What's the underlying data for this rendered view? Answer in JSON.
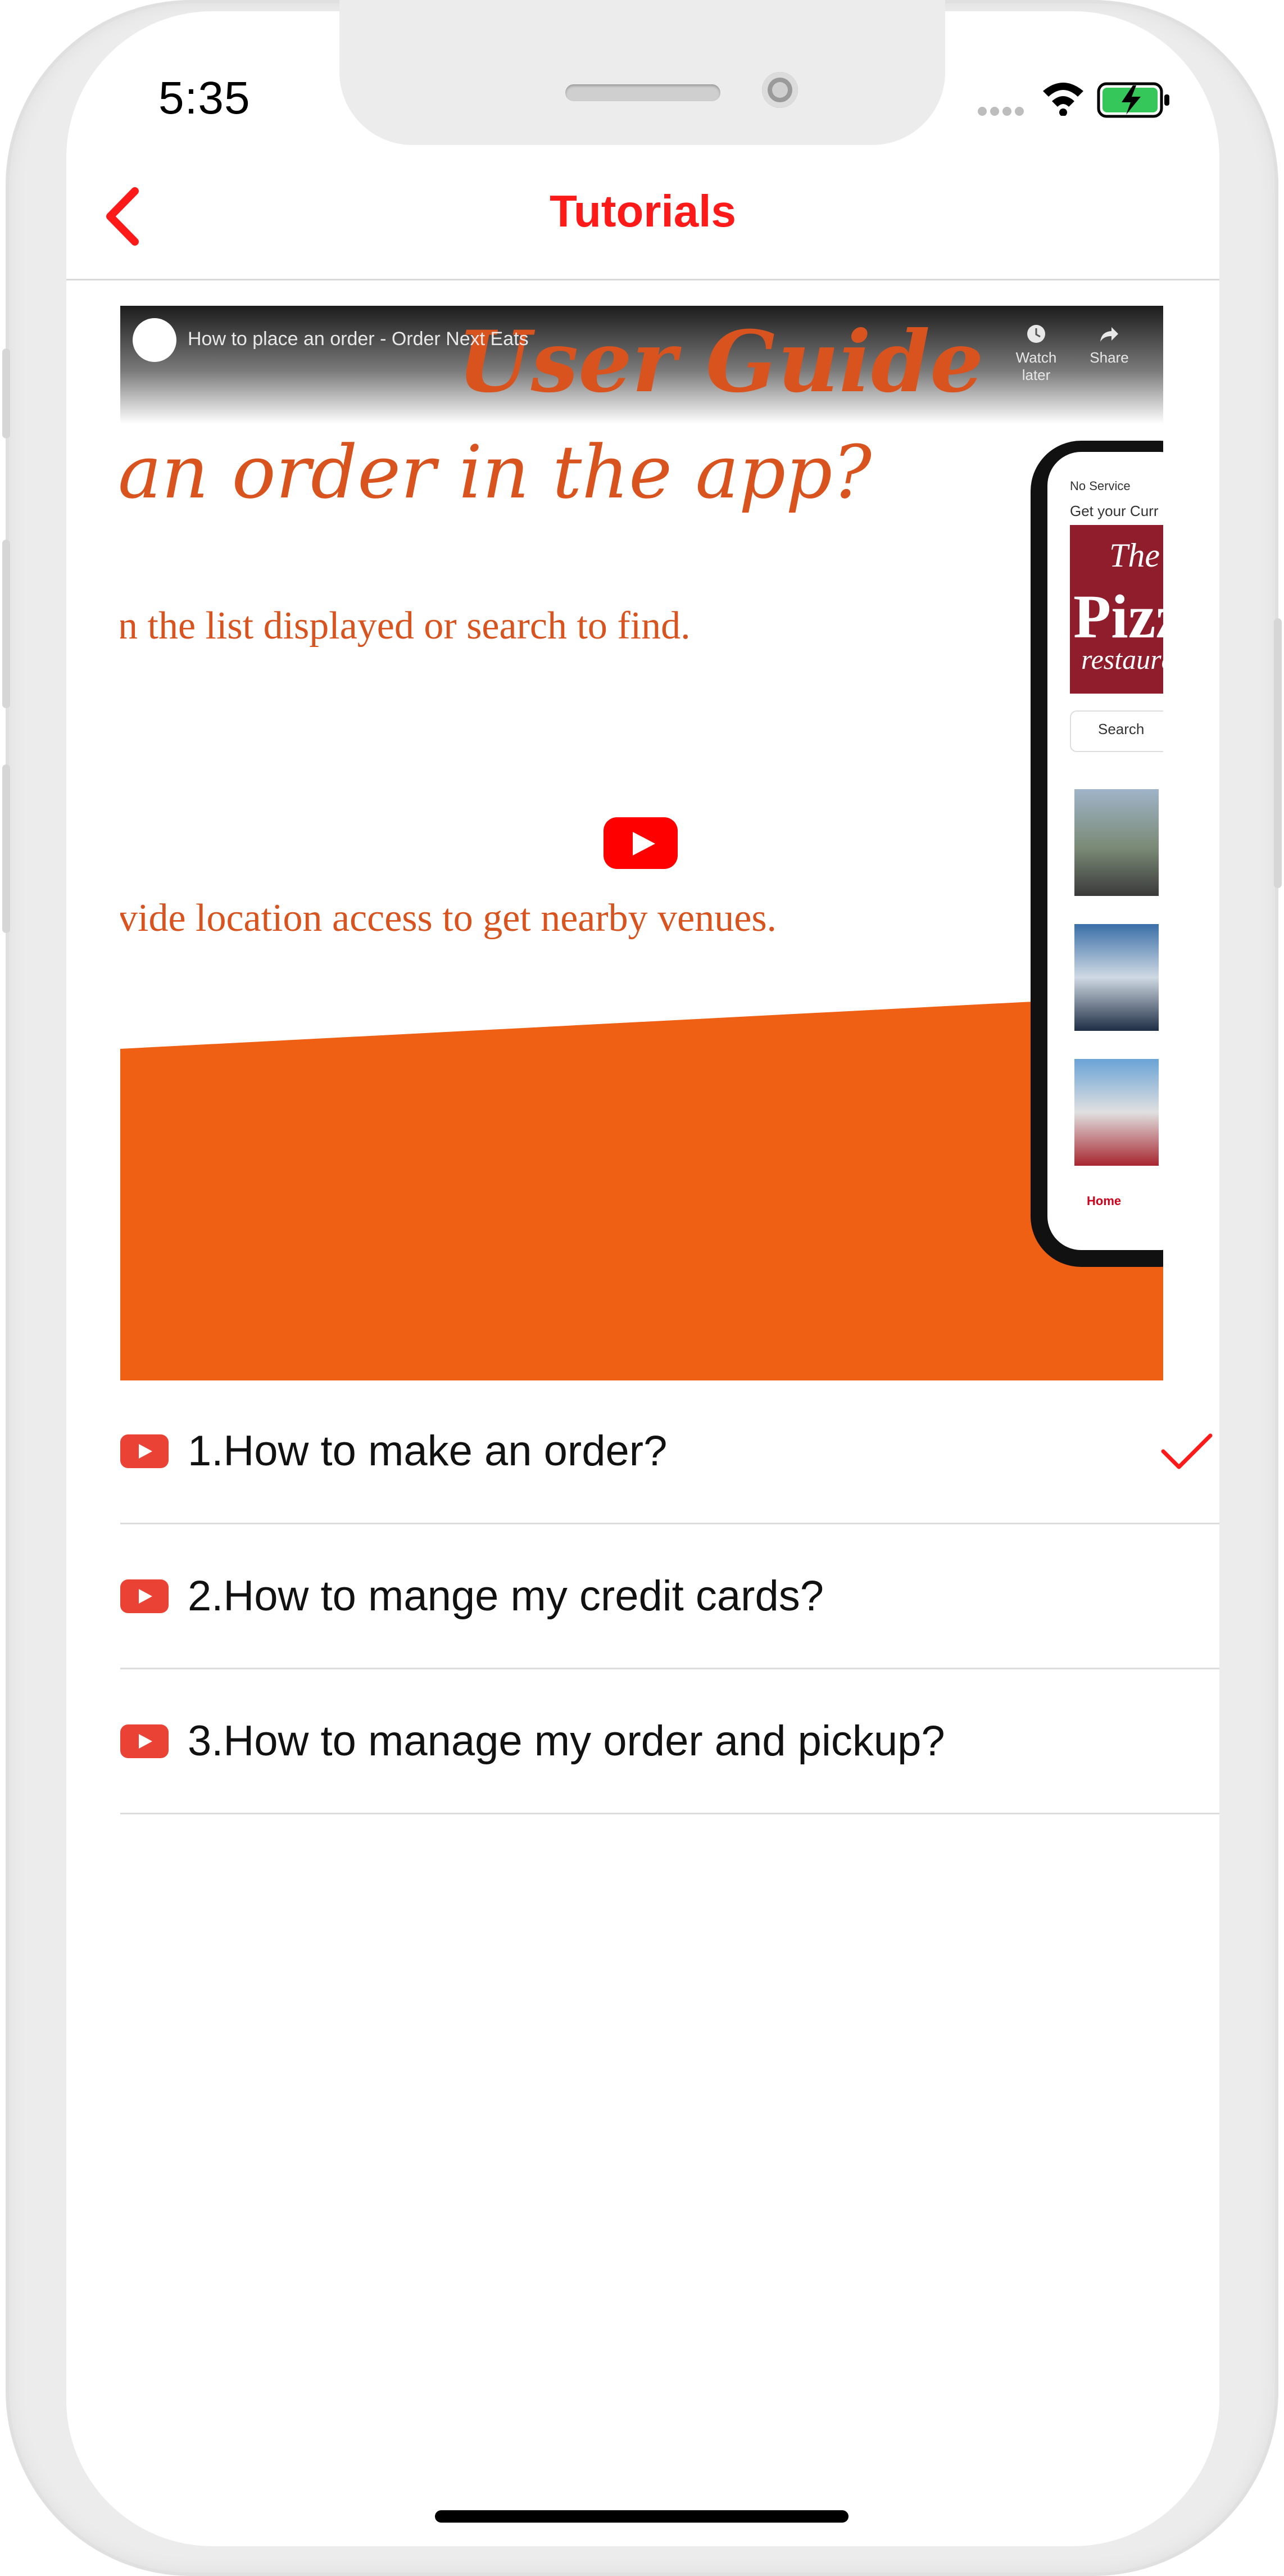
{
  "status_bar": {
    "time": "5:35",
    "icons": [
      "signal-dots-icon",
      "wifi-icon",
      "battery-charging-icon"
    ]
  },
  "nav": {
    "title": "Tutorials",
    "back_icon": "chevron-left-icon"
  },
  "video": {
    "caption": "How to place an order - Order Next Eats",
    "watch_later_label": "Watch later",
    "share_label": "Share",
    "slide_title": "User Guide",
    "slide_line1": "an order in the app?",
    "slide_line2": "n the list displayed or search to find.",
    "slide_line3": "vide location access to get nearby venues.",
    "mini_phone": {
      "status": "No Service",
      "location": "Get your Curr",
      "banner_the": "The",
      "banner_pizza": "Pizza",
      "banner_restaurant": "restaurant",
      "search_placeholder": "Search",
      "tab_home": "Home"
    },
    "play_icon": "youtube-play-icon"
  },
  "tutorials": [
    {
      "label": "1.How to make an order?",
      "selected": true
    },
    {
      "label": "2.How to mange my credit cards?",
      "selected": false
    },
    {
      "label": "3.How to manage my order and pickup?",
      "selected": false
    }
  ],
  "colors": {
    "accent": "#ff1a1a",
    "youtube_red": "#ea4335",
    "slide_orange": "#ef5f14"
  }
}
